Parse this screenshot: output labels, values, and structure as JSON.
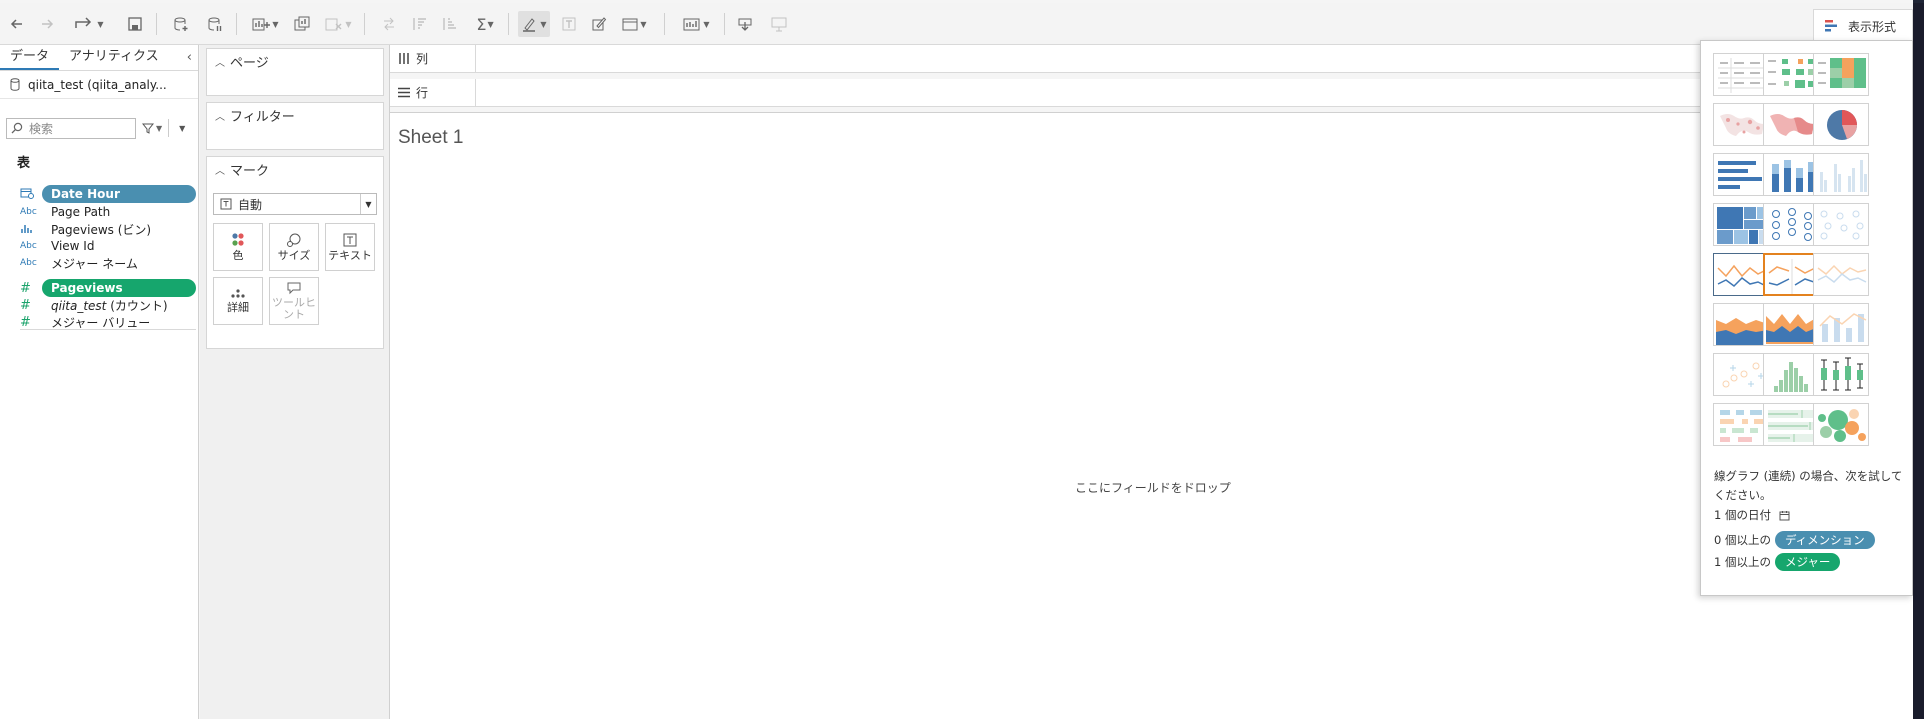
{
  "toolbar": {
    "icons": [
      "back-icon",
      "forward-icon",
      "redo-icon",
      "save-icon",
      "new-datasource-icon",
      "pause-icon",
      "new-worksheet-icon",
      "duplicate-icon",
      "clear-icon",
      "swap-icon",
      "sort-asc-icon",
      "sort-desc-icon",
      "aggregate-icon",
      "highlight-icon",
      "label-icon",
      "annotate-icon",
      "fit-icon",
      "show-cards-icon",
      "download-icon",
      "presentation-icon"
    ],
    "showme_label": "表示形式"
  },
  "data_pane": {
    "tabs": [
      "データ",
      "アナリティクス"
    ],
    "collapse": "‹",
    "datasource": "qiita_test (qiita_analy...",
    "search_placeholder": "検索",
    "table_header": "表",
    "dimensions": [
      {
        "type": "date",
        "label": "Date Hour"
      },
      {
        "type": "Abc",
        "label": "Page Path"
      },
      {
        "type": "bin",
        "label": "Pageviews (ビン)"
      },
      {
        "type": "Abc",
        "label": "View Id"
      },
      {
        "type": "Abc",
        "label": "メジャー ネーム"
      }
    ],
    "measures": [
      {
        "type": "#",
        "label": "Pageviews"
      },
      {
        "type": "#",
        "label_italic": "qiita_test",
        "label_rest": " (カウント)"
      },
      {
        "type": "#",
        "label": "メジャー バリュー"
      }
    ]
  },
  "cards": {
    "pages": "ページ",
    "filters": "フィルター",
    "marks": "マーク",
    "mark_type": "自動",
    "mark_buttons": [
      "色",
      "サイズ",
      "テキスト",
      "詳細",
      "ツールヒント"
    ]
  },
  "shelves": {
    "columns": "列",
    "rows": "行"
  },
  "viz": {
    "sheet_title": "Sheet 1",
    "drop_text": "ここにフィールドをドロップ"
  },
  "showme": {
    "hint_text": "線グラフ (連続) の場合、次を試してください。",
    "req1_count": "1 個の日付",
    "req2_count": "0 個以上の",
    "req2_pill": "ディメンション",
    "req3_count": "1 個以上の",
    "req3_pill": "メジャー",
    "charts": [
      "text-table",
      "heat-map",
      "highlight-table",
      "symbol-map",
      "filled-map",
      "pie-chart",
      "horizontal-bars",
      "stacked-bars",
      "side-by-side-bars",
      "treemap",
      "circle-views",
      "side-by-side-circles",
      "line-continuous",
      "line-discrete",
      "dual-lines",
      "area-continuous",
      "area-discrete",
      "dual-combination",
      "scatter-plot",
      "histogram",
      "box-whisker",
      "gantt-chart",
      "bullet-graph",
      "packed-bubbles"
    ],
    "selected": "line-discrete",
    "current": "line-continuous"
  },
  "colors": {
    "accent_blue": "#4a8fb0",
    "measure_green": "#16a66d",
    "selected_orange": "#e3821f"
  }
}
